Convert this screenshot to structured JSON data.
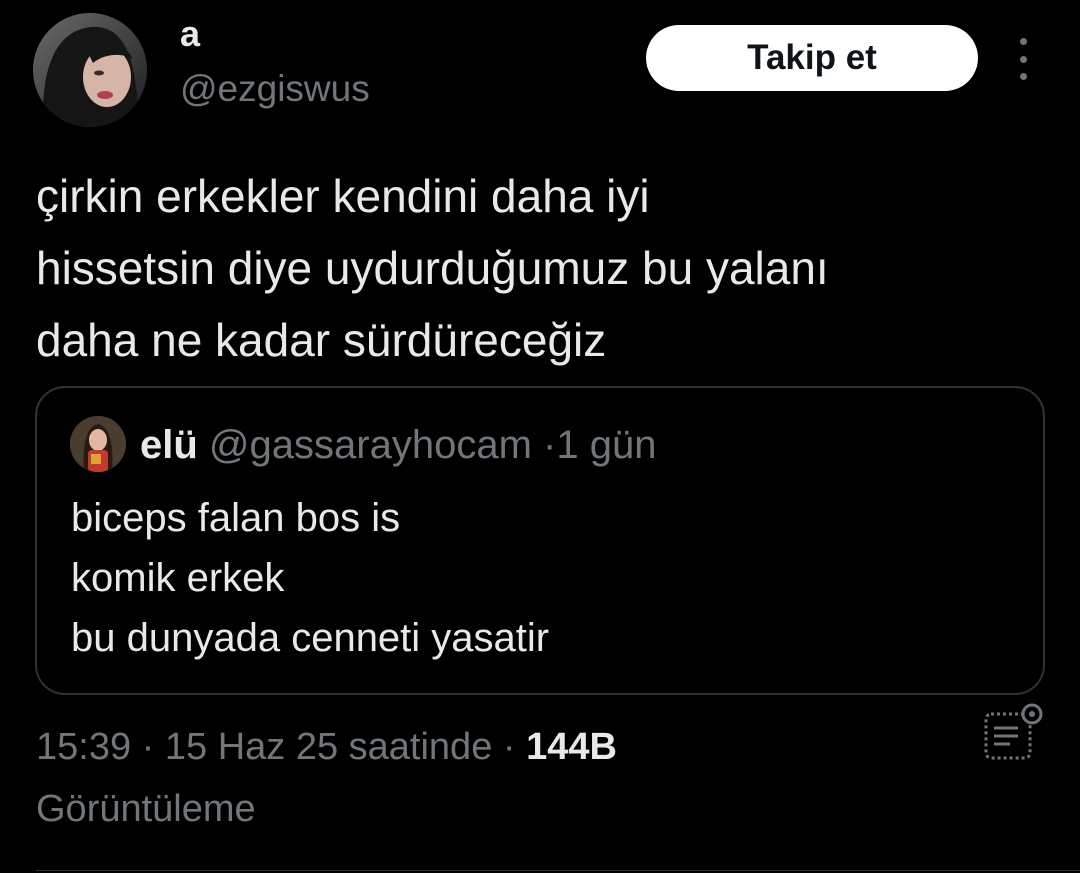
{
  "author": {
    "display_name": "a",
    "handle": "@ezgiswus",
    "avatar_icon": "profile-photo"
  },
  "actions": {
    "follow_label": "Takip et",
    "more_icon": "more-vertical-icon"
  },
  "tweet": {
    "lines": [
      "çirkin erkekler kendini daha iyi",
      "hissetsin diye uydurduğumuz bu yalanı",
      "daha ne kadar sürdüreceğiz"
    ]
  },
  "quote": {
    "name": "elü",
    "handle": "@gassarayhocam",
    "separator": "·",
    "time": "1 gün",
    "lines": [
      "biceps falan bos is",
      "komik erkek",
      "bu dunyada cenneti yasatir"
    ]
  },
  "meta": {
    "time": "15:39",
    "separator": "·",
    "date": "15 Haz 25 saatinde",
    "views_count": "144B",
    "views_label": "Görüntüleme"
  },
  "colors": {
    "background": "#000000",
    "text_primary": "#e7e9ea",
    "text_secondary": "#71767b",
    "border": "#2f3336",
    "button_bg": "#ffffff"
  }
}
